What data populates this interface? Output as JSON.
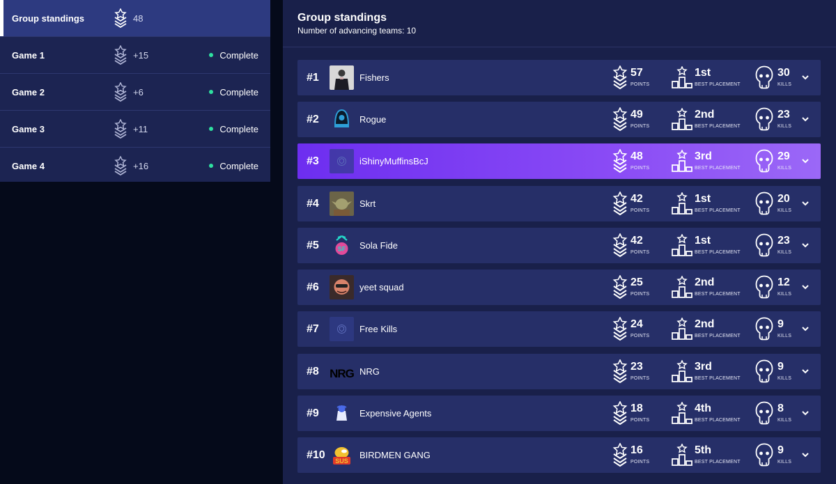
{
  "sidebar": {
    "items": [
      {
        "label": "Group standings",
        "points": "48",
        "status": ""
      },
      {
        "label": "Game 1",
        "points": "+15",
        "status": "Complete"
      },
      {
        "label": "Game 2",
        "points": "+6",
        "status": "Complete"
      },
      {
        "label": "Game 3",
        "points": "+11",
        "status": "Complete"
      },
      {
        "label": "Game 4",
        "points": "+16",
        "status": "Complete"
      }
    ]
  },
  "header": {
    "title": "Group standings",
    "subtitle": "Number of advancing teams: 10"
  },
  "labels": {
    "points": "POINTS",
    "placement": "BEST PLACEMENT",
    "kills": "KILLS"
  },
  "colors": {
    "accent": "#7c3aed",
    "status_dot": "#2fe0a0",
    "row_bg": "#262f68",
    "panel_bg": "#19204a"
  },
  "standings": [
    {
      "rank": "#1",
      "name": "Fishers",
      "points": "57",
      "placement": "1st",
      "kills": "30",
      "logo": "player-photo"
    },
    {
      "rank": "#2",
      "name": "Rogue",
      "points": "49",
      "placement": "2nd",
      "kills": "23",
      "logo": "rogue-logo"
    },
    {
      "rank": "#3",
      "name": "iShinyMuffinsBcJ",
      "points": "48",
      "placement": "3rd",
      "kills": "29",
      "logo": "placeholder-shield"
    },
    {
      "rank": "#4",
      "name": "Skrt",
      "points": "42",
      "placement": "1st",
      "kills": "20",
      "logo": "yoda-avatar"
    },
    {
      "rank": "#5",
      "name": "Sola Fide",
      "points": "42",
      "placement": "1st",
      "kills": "23",
      "logo": "sola-fide-logo"
    },
    {
      "rank": "#6",
      "name": "yeet squad",
      "points": "25",
      "placement": "2nd",
      "kills": "12",
      "logo": "yeet-avatar"
    },
    {
      "rank": "#7",
      "name": "Free Kills",
      "points": "24",
      "placement": "2nd",
      "kills": "9",
      "logo": "placeholder-shield"
    },
    {
      "rank": "#8",
      "name": "NRG",
      "points": "23",
      "placement": "3rd",
      "kills": "9",
      "logo": "nrg-logo"
    },
    {
      "rank": "#9",
      "name": "Expensive Agents",
      "points": "18",
      "placement": "4th",
      "kills": "8",
      "logo": "expensive-agents-logo"
    },
    {
      "rank": "#10",
      "name": "BIRDMEN GANG",
      "points": "16",
      "placement": "5th",
      "kills": "9",
      "logo": "sus-logo"
    }
  ]
}
